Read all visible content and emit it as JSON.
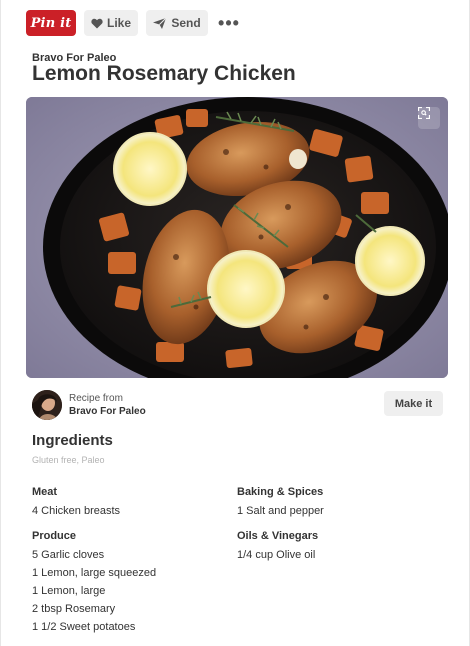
{
  "toolbar": {
    "pin_label": "Pin it",
    "like_label": "Like",
    "send_label": "Send",
    "more_label": "•••"
  },
  "pin": {
    "source": "Bravo For Paleo",
    "title": "Lemon Rosemary Chicken"
  },
  "recipe_from": {
    "label": "Recipe from",
    "source": "Bravo For Paleo",
    "make_label": "Make it"
  },
  "ingredients": {
    "heading": "Ingredients",
    "tags": "Gluten free, Paleo",
    "left_groups": [
      {
        "title": "Meat",
        "items": [
          "4 Chicken breasts"
        ]
      },
      {
        "title": "Produce",
        "items": [
          "5 Garlic cloves",
          "1 Lemon, large squeezed",
          "1 Lemon, large",
          "2 tbsp Rosemary",
          "1 1/2 Sweet potatoes"
        ]
      }
    ],
    "right_groups": [
      {
        "title": "Baking & Spices",
        "items": [
          "1 Salt and pepper"
        ]
      },
      {
        "title": "Oils & Vinegars",
        "items": [
          "1/4 cup Olive oil"
        ]
      }
    ]
  },
  "colors": {
    "pin_red": "#cb2027",
    "button_gray": "#efefef",
    "text_dark": "#333333",
    "tag_gray": "#b3b3b3"
  },
  "icons": [
    "heart-icon",
    "paper-plane-icon",
    "more-dots-icon",
    "expand-icon"
  ]
}
